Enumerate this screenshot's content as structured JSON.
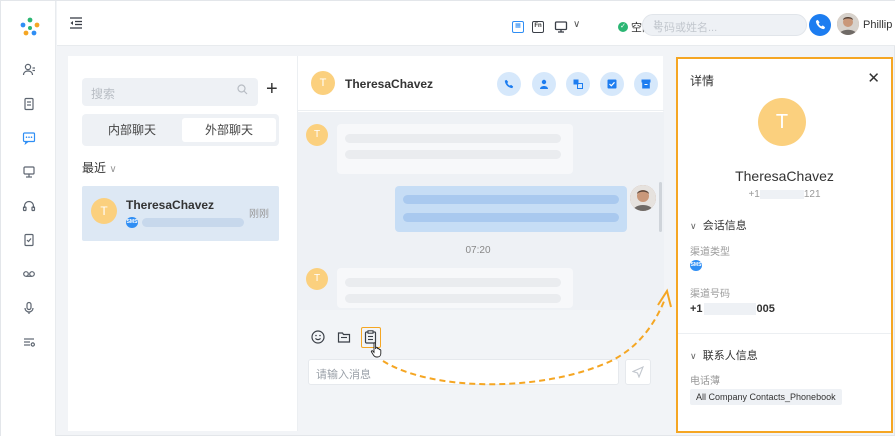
{
  "topbar": {
    "status_label": "空闲",
    "search_placeholder": "号码或姓名...",
    "user_name": "Phillip Huff"
  },
  "chat_list": {
    "search_placeholder": "搜索",
    "tab_internal": "内部聊天",
    "tab_external": "外部聊天",
    "recent_label": "最近",
    "item": {
      "avatar_letter": "T",
      "name": "TheresaChavez",
      "time": "刚刚",
      "channel_badge": "SMS"
    }
  },
  "chat": {
    "avatar_letter": "T",
    "contact_name": "TheresaChavez",
    "timestamp": "07:20",
    "input_placeholder": "请输入消息"
  },
  "detail": {
    "title": "详情",
    "avatar_letter": "T",
    "name": "TheresaChavez",
    "phone_prefix": "+1",
    "phone_suffix": "121",
    "session_section": "会话信息",
    "channel_type_label": "渠道类型",
    "channel_badge": "SMS",
    "channel_number_label": "渠道号码",
    "channel_number_prefix": "+1",
    "channel_number_suffix": "005",
    "contact_section": "联系人信息",
    "phonebook_label": "电话薄",
    "phonebook_value": "All Company Contacts_Phonebook"
  },
  "colors": {
    "accent": "#1d7df0",
    "highlight": "#f5a623",
    "avatar": "#fbd07e",
    "online": "#2bb673"
  }
}
